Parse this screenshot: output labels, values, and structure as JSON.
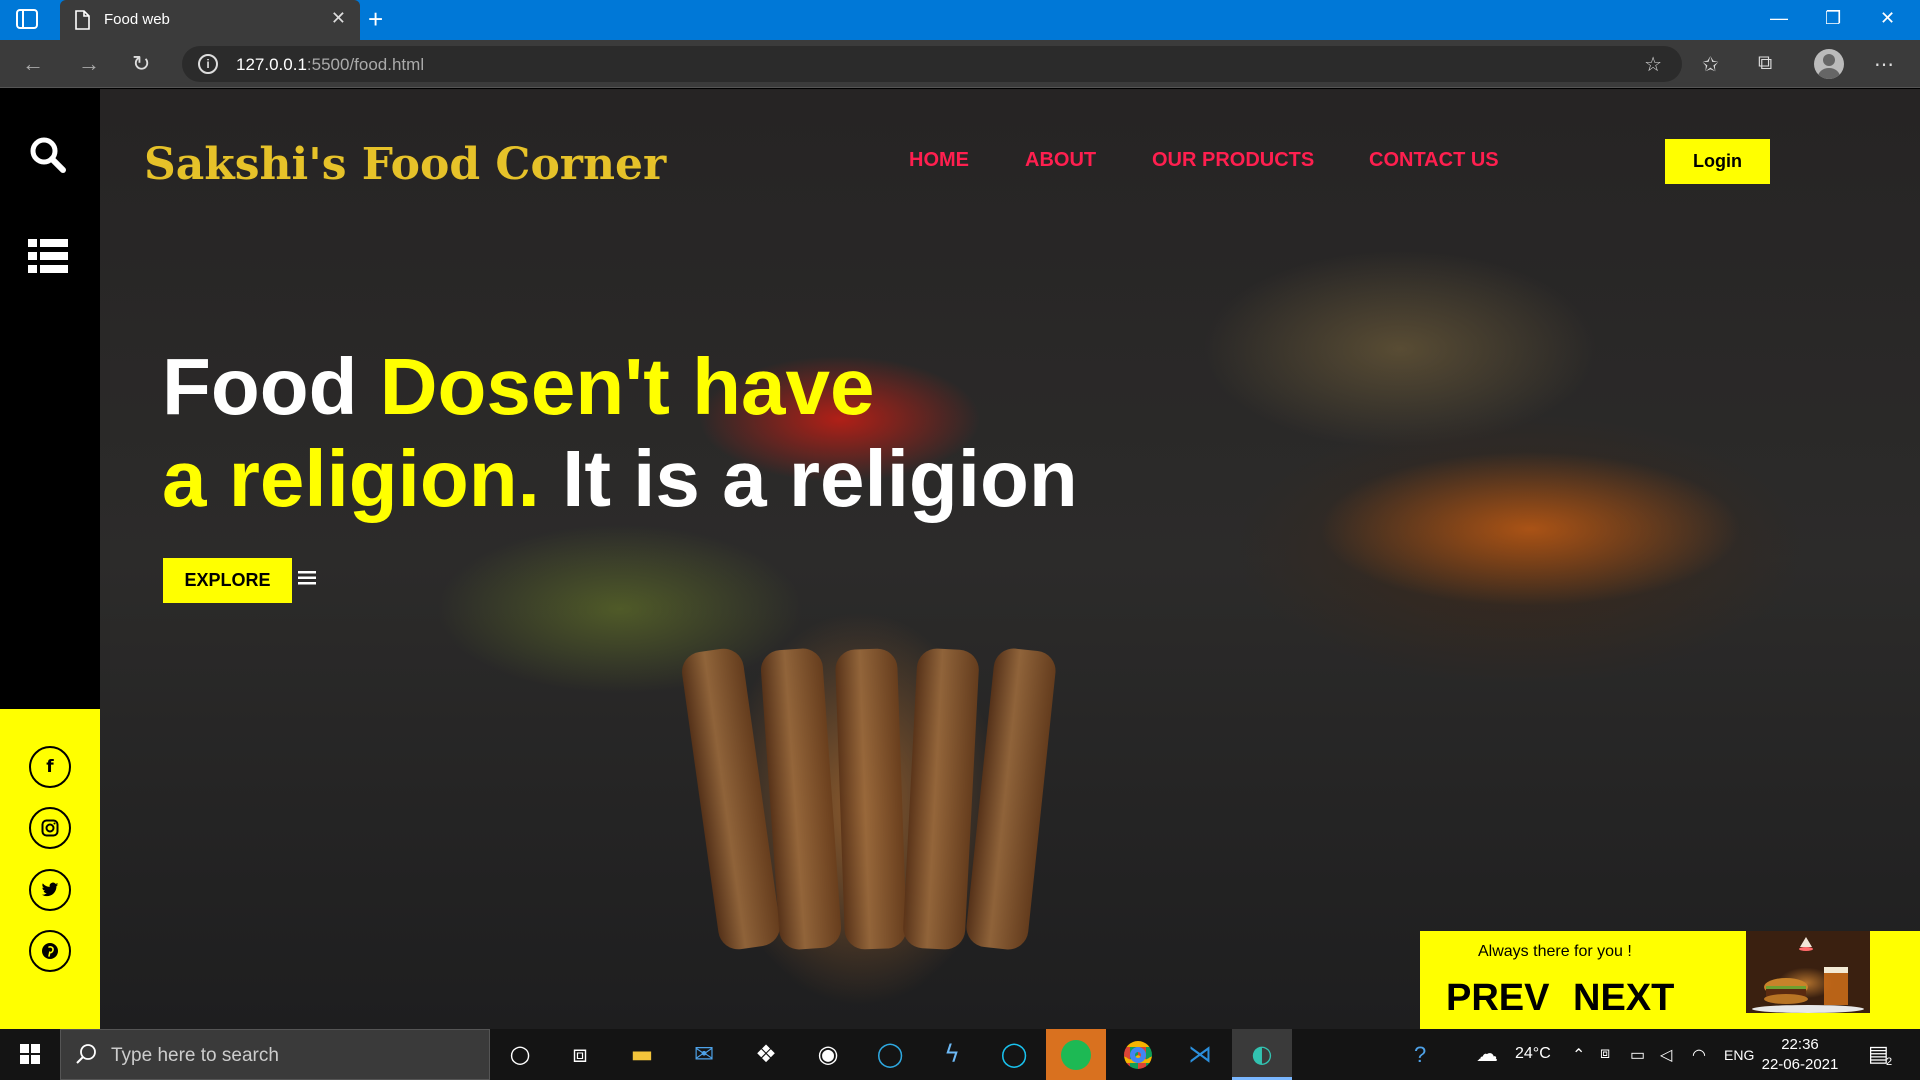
{
  "browser": {
    "tab_title": "Food web",
    "url_host": "127.0.0.1",
    "url_rest": ":5500/food.html"
  },
  "site": {
    "brand": "Sakshi's Food Corner",
    "nav": [
      "HOME",
      "ABOUT",
      "OUR PRODUCTS",
      "CONTACT US"
    ],
    "login_label": "Login",
    "headline": {
      "line1_white": "Food ",
      "line1_yellow": "Dosen't have",
      "line2_yellow": "a religion.",
      "line2_white": " It is a religion"
    },
    "explore_label": "EXPLORE",
    "social_icons": [
      "facebook-icon",
      "instagram-icon",
      "twitter-icon",
      "pinterest-icon"
    ],
    "promo": {
      "tagline": "Always there for you !",
      "prev_label": "PREV",
      "next_label": "NEXT"
    },
    "colors": {
      "accent_yellow": "#ffff00",
      "nav_red": "#ff1f4f",
      "brand_gold": "#e6c229"
    }
  },
  "taskbar": {
    "search_placeholder": "Type here to search",
    "weather": "24°C",
    "language": "ENG",
    "time": "22:36",
    "date": "22-06-2021",
    "notification_count": "2"
  }
}
